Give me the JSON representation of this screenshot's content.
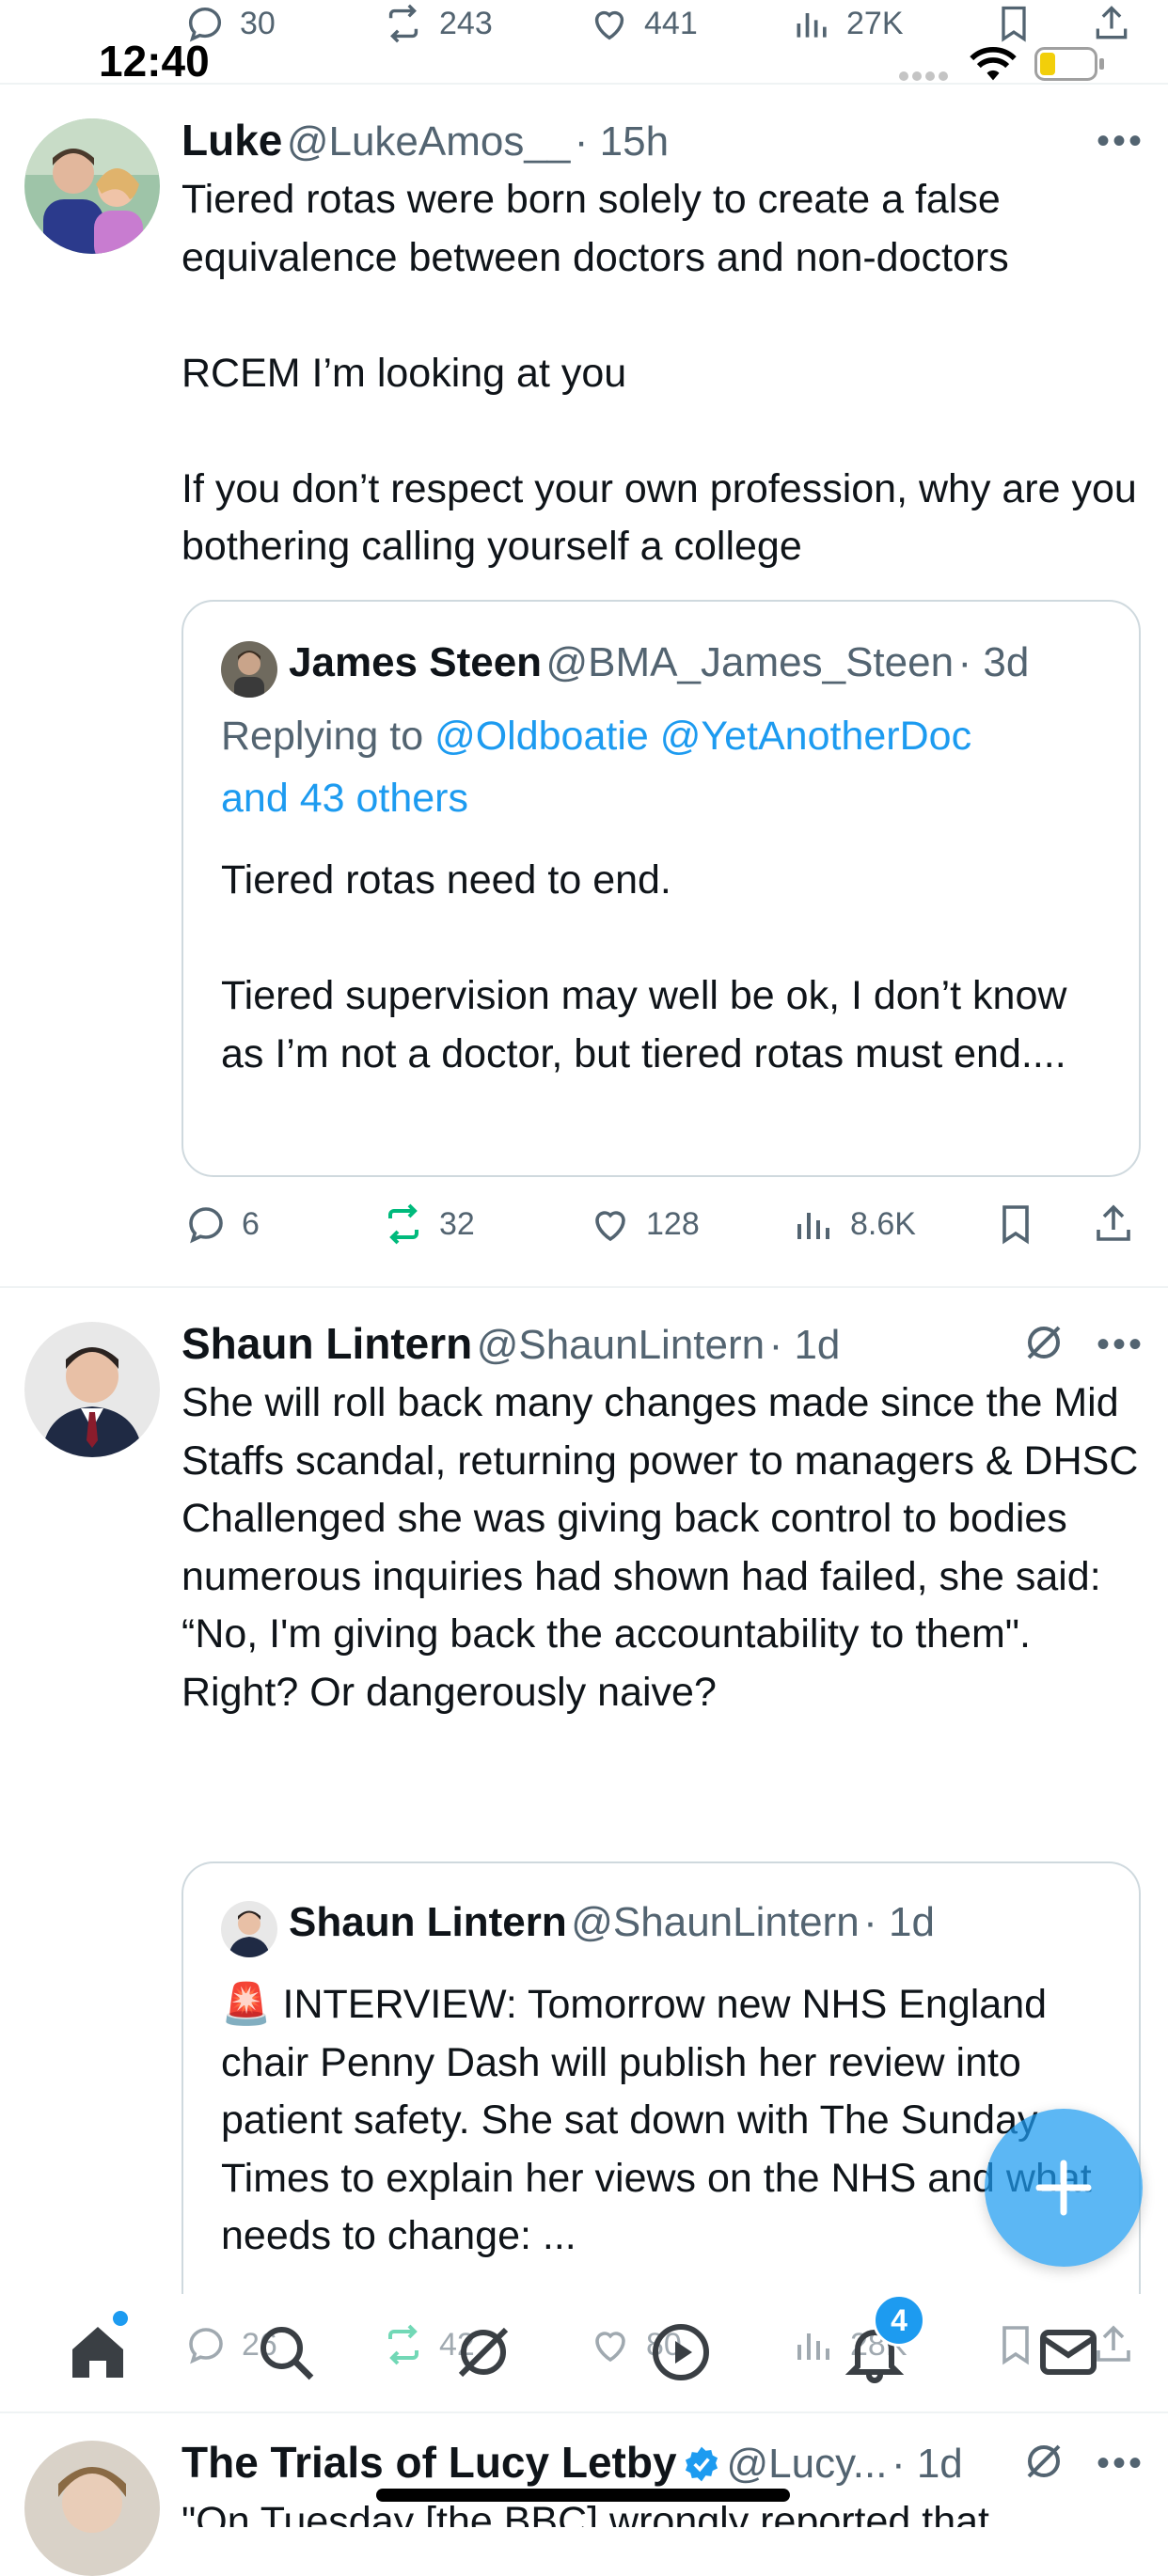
{
  "status_bar": {
    "time": "12:40"
  },
  "top_actions": {
    "replies": "30",
    "reposts": "243",
    "likes": "441",
    "views": "27K"
  },
  "tweets": [
    {
      "name": "Luke",
      "handle": "@LukeAmos__",
      "time": "· 15h",
      "text": "Tiered rotas were born solely to create a false equivalence between doctors and non-doctors\n\nRCEM I’m looking at you\n\nIf you don’t respect your own profession, why are you bothering calling yourself a college",
      "quote": {
        "name": "James Steen",
        "handle": "@BMA_James_Steen",
        "time": "· 3d",
        "replying_prefix": "Replying to ",
        "replying_mentions": "@Oldboatie @YetAnotherDoc",
        "replying_rest": "and 43 others",
        "text": "Tiered rotas need to end.\n\nTiered supervision may well be ok, I don’t know as I’m not a doctor, but tiered rotas must end...."
      },
      "actions": {
        "replies": "6",
        "reposts": "32",
        "likes": "128",
        "views": "8.6K"
      }
    },
    {
      "name": "Shaun Lintern",
      "handle": "@ShaunLintern",
      "time": "· 1d",
      "text": "She will roll back many changes made since the Mid Staffs scandal, returning power to managers & DHSC\nChallenged she was giving back control to bodies numerous inquiries had shown had failed, she said: “No, I'm giving back the accountability to them\". Right? Or dangerously naive?",
      "quote": {
        "name": "Shaun Lintern",
        "handle": "@ShaunLintern",
        "time": "· 1d",
        "emoji": "🚨",
        "text": "INTERVIEW: Tomorrow new NHS England chair Penny Dash will publish her review into patient safety. She sat down with The Sunday Times to explain her views on the NHS and what needs to change: ..."
      },
      "actions": {
        "replies": "26",
        "reposts": "42",
        "likes": "80",
        "views": "28K"
      }
    },
    {
      "name": "The Trials of Lucy Letby",
      "handle": "@Lucy...",
      "time": "· 1d",
      "text": "\"On Tuesday [the BBC] wrongly reported that"
    }
  ],
  "tab_bar": {
    "notifications_badge": "4"
  },
  "colors": {
    "accent": "#1d9bf0",
    "repost_active": "#00ba7c",
    "text": "#0f1419",
    "muted": "#536471"
  }
}
